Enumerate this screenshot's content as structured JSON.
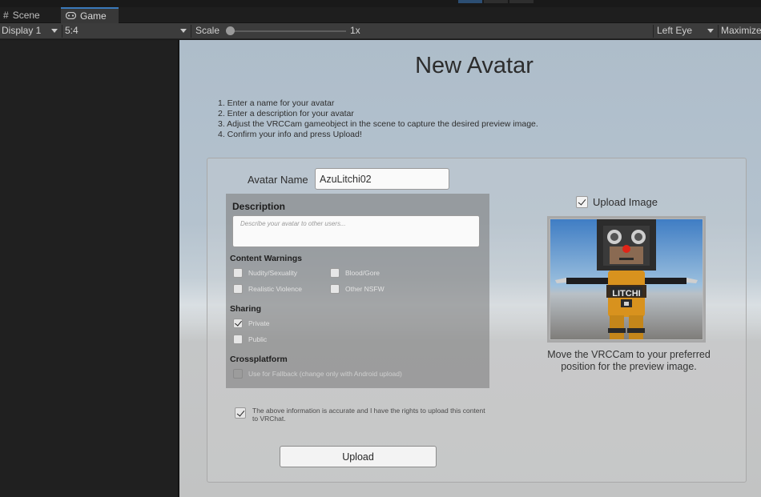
{
  "editor": {
    "tabs": [
      {
        "label": "Scene",
        "icon": "grid-icon"
      },
      {
        "label": "Game",
        "icon": "gamepad-icon"
      }
    ],
    "toolbar": {
      "display": "Display 1",
      "aspect": "5:4",
      "scale_label": "Scale",
      "scale_value": "1x",
      "eye": "Left Eye",
      "maximize": "Maximize"
    }
  },
  "form": {
    "title": "New Avatar",
    "instructions": [
      "1. Enter a name for your avatar",
      "2. Enter a description for your avatar",
      "3. Adjust the VRCCam gameobject in the scene to capture the desired preview image.",
      "4. Confirm your info and press Upload!"
    ],
    "avatar_name_label": "Avatar Name",
    "avatar_name_value": "AzuLitchi02",
    "description_heading": "Description",
    "description_placeholder": "Describe your avatar to other users...",
    "content_warnings": {
      "heading": "Content Warnings",
      "items": [
        {
          "label": "Nudity/Sexuality",
          "checked": false
        },
        {
          "label": "Blood/Gore",
          "checked": false
        },
        {
          "label": "Realistic Violence",
          "checked": false
        },
        {
          "label": "Other NSFW",
          "checked": false
        }
      ]
    },
    "sharing": {
      "heading": "Sharing",
      "items": [
        {
          "label": "Private",
          "checked": true
        },
        {
          "label": "Public",
          "checked": false
        }
      ]
    },
    "crossplatform": {
      "heading": "Crossplatform",
      "item": {
        "label": "Use for Fallback (change only with Android upload)",
        "checked": false,
        "disabled": true
      }
    },
    "accept_text": "The above information is accurate and I have the rights to upload this content to VRChat.",
    "accept_checked": true,
    "upload_button": "Upload",
    "upload_image_label": "Upload Image",
    "upload_image_checked": true,
    "preview_caption": "Move the VRCCam to your preferred position for the preview image.",
    "preview_badge_text": "LITCHI"
  }
}
